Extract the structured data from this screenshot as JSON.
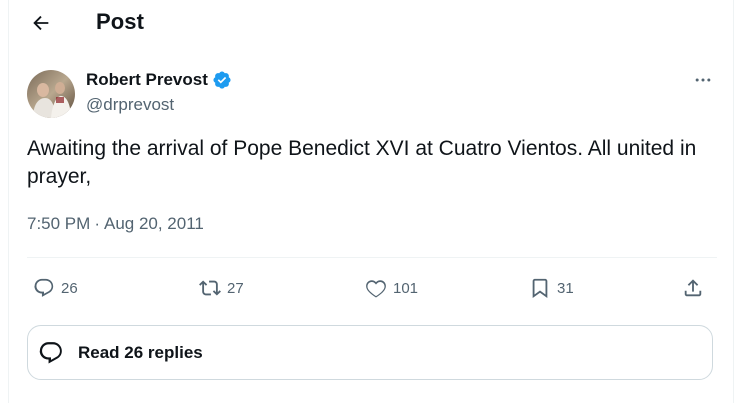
{
  "header": {
    "title": "Post",
    "back_icon": "arrow-left-icon"
  },
  "author": {
    "name": "Robert Prevost",
    "handle": "@drprevost",
    "verified_color": "#1d9bf0",
    "avatar_icon": "avatar-photo"
  },
  "post": {
    "text": "Awaiting the arrival of Pope Benedict XVI at Cuatro Vientos. All united in prayer,",
    "time": "7:50 PM",
    "separator": "·",
    "date": "Aug 20, 2011"
  },
  "actions": {
    "replies": "26",
    "reposts": "27",
    "likes": "101",
    "bookmarks": "31"
  },
  "read_replies": {
    "label": "Read 26 replies"
  },
  "colors": {
    "text": "#0f1419",
    "secondary": "#536471",
    "border": "#cfd9de",
    "divider": "#eff3f4"
  }
}
